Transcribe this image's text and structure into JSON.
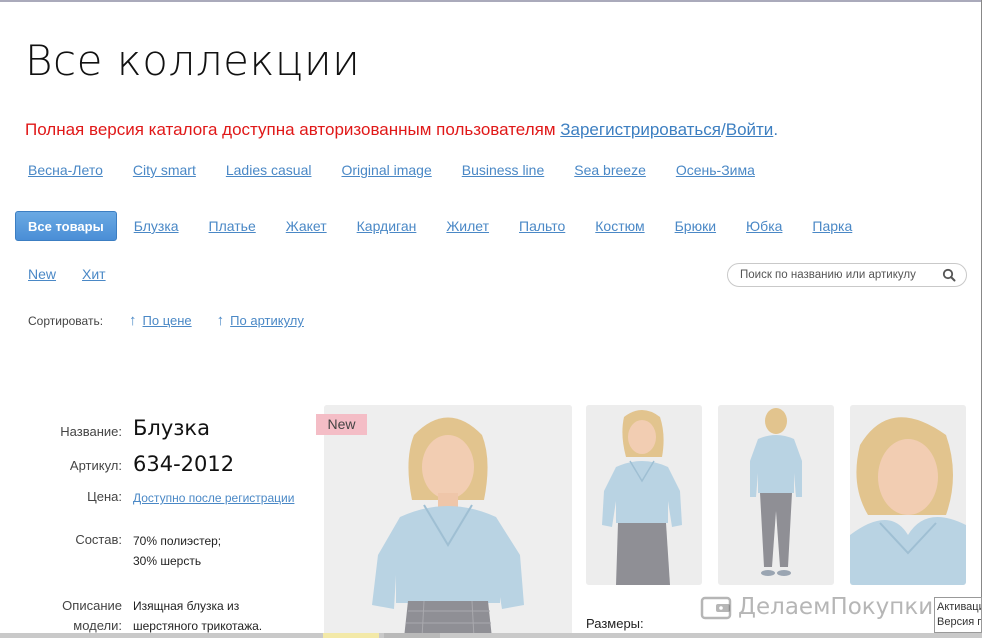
{
  "page": {
    "title": "Все коллекции",
    "notice": {
      "text": "Полная версия каталога доступна авторизованным пользователям",
      "register_link": "Зарегистрироваться",
      "separator": "/",
      "login_link": "Войти",
      "end": "."
    }
  },
  "collections": [
    "Весна-Лето",
    "City smart",
    "Ladies casual",
    "Original image",
    "Business line",
    "Sea breeze",
    "Осень-Зима"
  ],
  "categories": {
    "active": "Все товары",
    "items": [
      "Блузка",
      "Платье",
      "Жакет",
      "Кардиган",
      "Жилет",
      "Пальто",
      "Костюм",
      "Брюки",
      "Юбка",
      "Парка"
    ]
  },
  "tags": [
    "New",
    "Хит"
  ],
  "search": {
    "placeholder": "Поиск по названию или артикулу",
    "icon": "search-icon"
  },
  "sort": {
    "label": "Сортировать:",
    "options": [
      "По цене",
      "По артикулу"
    ],
    "icon": "arrow-up-icon"
  },
  "product": {
    "name_label": "Название:",
    "name": "Блузка",
    "article_label": "Артикул:",
    "article": "634-2012",
    "price_label": "Цена:",
    "price_link": "Доступно после регистрации",
    "composition_label": "Состав:",
    "composition": [
      "70% полиэстер;",
      "30% шерсть"
    ],
    "description_label": [
      "Описание",
      "модели:"
    ],
    "description": [
      "Изящная блузка из",
      "шерстяного трикотажа."
    ],
    "badge": "New",
    "sizes_label": "Размеры:"
  },
  "watermark": {
    "text": "ДелаемПокупки.Ру",
    "icon": "wallet-icon"
  },
  "corner_window": {
    "lines": [
      "Активация",
      "Версия п"
    ]
  },
  "colors": {
    "accent": "#4a88c6",
    "notice": "#e01818",
    "button": "#4a8ed6",
    "badge": "#f4bdc6",
    "garment": "#b9d3e3"
  }
}
